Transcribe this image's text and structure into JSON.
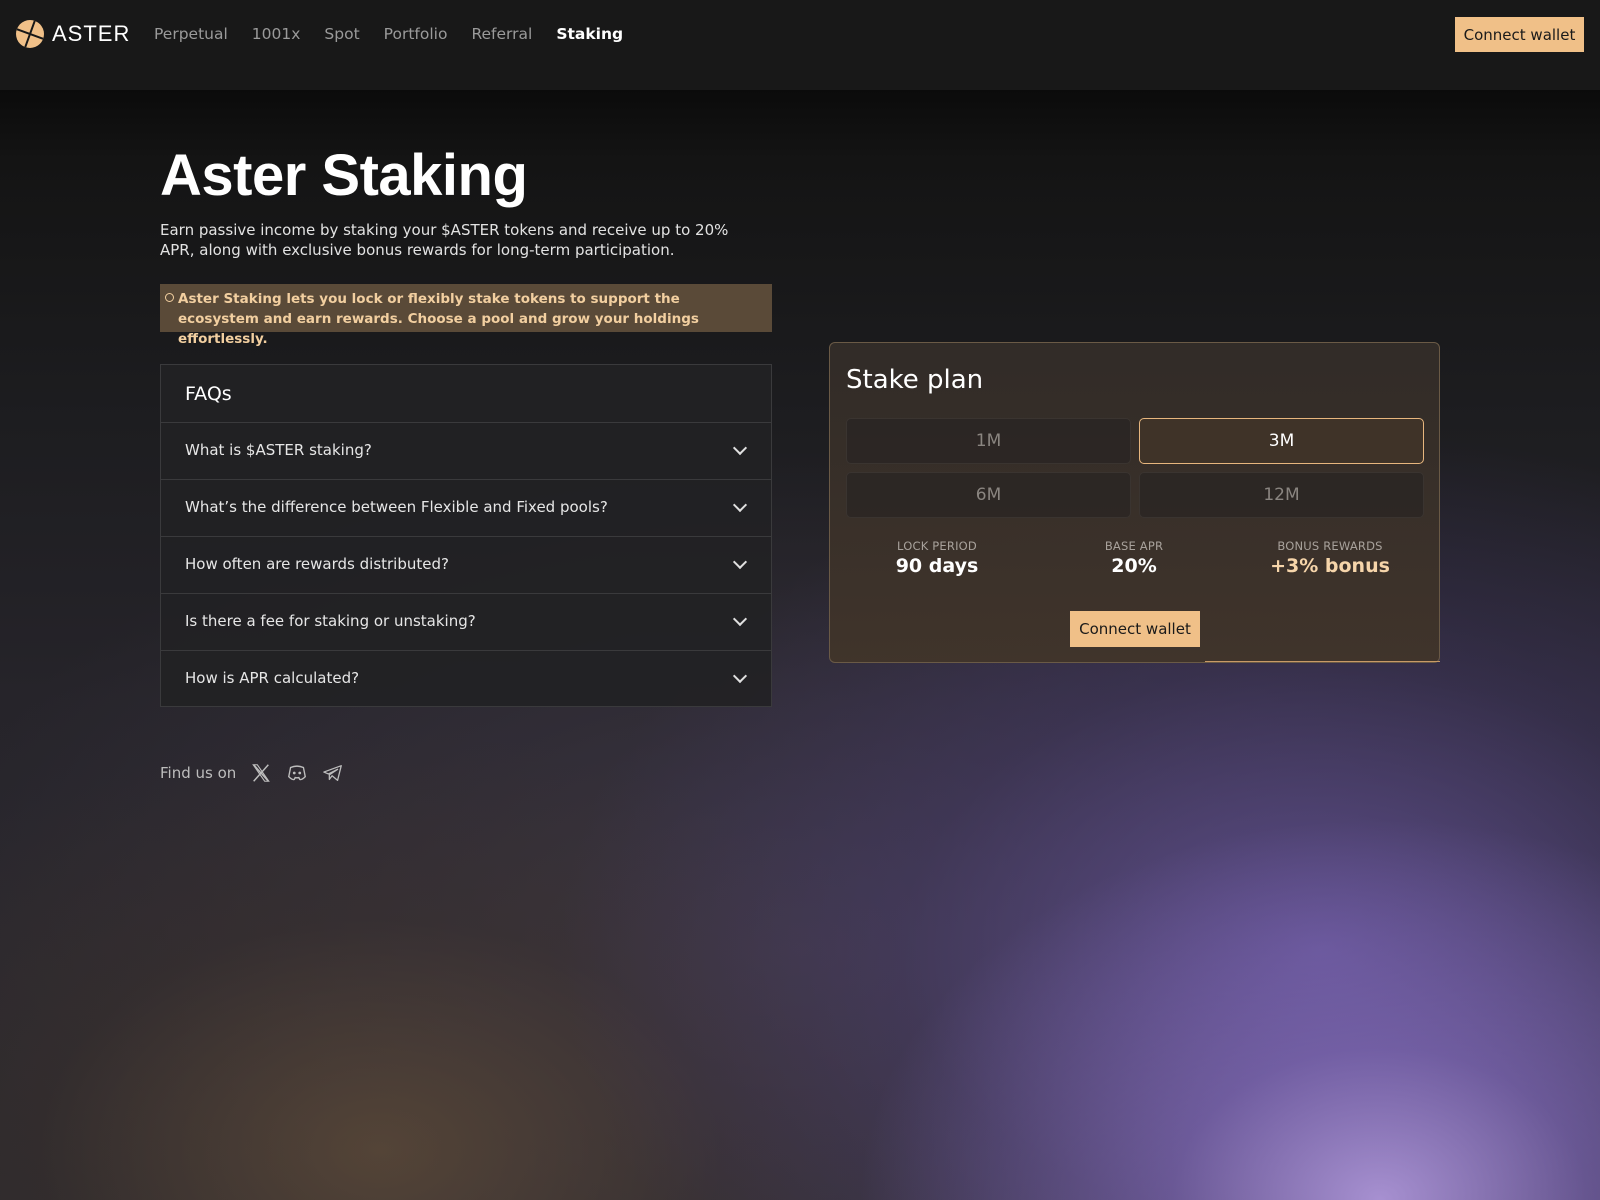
{
  "nav": {
    "logo_text": "ASTER",
    "links": [
      {
        "label": "Perpetual",
        "active": false
      },
      {
        "label": "1001x",
        "active": false
      },
      {
        "label": "Spot",
        "active": false
      },
      {
        "label": "Portfolio",
        "active": false
      },
      {
        "label": "Referral",
        "active": false
      },
      {
        "label": "Staking",
        "active": true
      }
    ],
    "connect_label": "Connect wallet"
  },
  "hero": {
    "title": "Aster Staking",
    "description": "Earn passive income by staking your $ASTER tokens and receive up to 20% APR, along with exclusive bonus rewards for long-term participation.",
    "notice": "Aster Staking lets you lock or flexibly stake tokens to support the ecosystem and earn rewards. Choose a pool and grow your holdings effortlessly."
  },
  "faq": {
    "title": "FAQs",
    "items": [
      "What is $ASTER staking?",
      "What’s the difference between Flexible and Fixed pools?",
      "How often are rewards distributed?",
      "Is there a fee for staking or unstaking?",
      "How is APR calculated?"
    ]
  },
  "find_us": {
    "label": "Find us on",
    "icons": [
      "x-icon",
      "discord-icon",
      "telegram-icon"
    ]
  },
  "stake_plan": {
    "title": "Stake plan",
    "plans": [
      {
        "label": "1M",
        "selected": false
      },
      {
        "label": "3M",
        "selected": true
      },
      {
        "label": "6M",
        "selected": false
      },
      {
        "label": "12M",
        "selected": false
      }
    ],
    "stats": {
      "lock_period_label": "LOCK PERIOD",
      "lock_period_value": "90 days",
      "base_apr_label": "BASE APR",
      "base_apr_value": "20%",
      "bonus_label": "BONUS REWARDS",
      "bonus_value": "+3% bonus"
    },
    "connect_label": "Connect wallet"
  },
  "colors": {
    "accent": "#f0c088",
    "notice_bg": "#5a4a38",
    "notice_text": "#f2cfa0",
    "selected_border": "#e7b67e"
  }
}
